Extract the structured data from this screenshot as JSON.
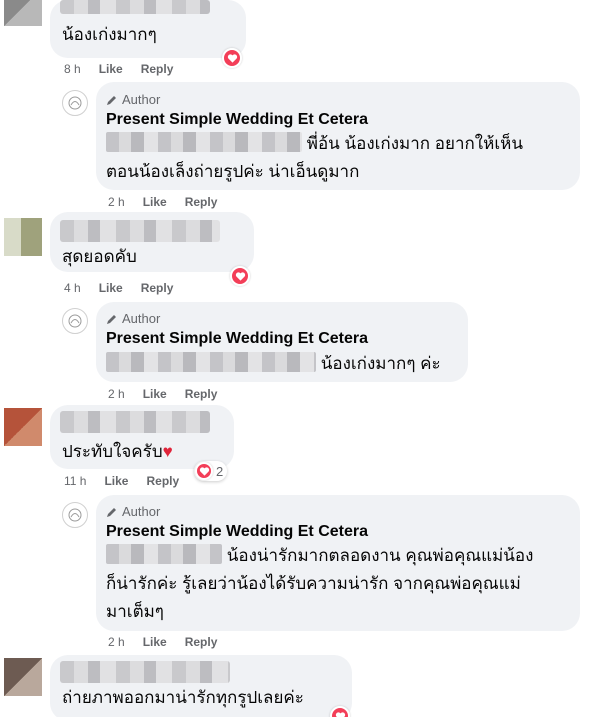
{
  "comments": [
    {
      "text": "น้องเก่งมากๆ",
      "time": "8 h",
      "like": "Like",
      "reply": "Reply",
      "reaction_count": "",
      "page_reply": {
        "author_label": "Author",
        "page_name": "Present Simple Wedding Et Cetera",
        "line1": "พี่อ้น น้องเก่งมาก อยากให้เห็น",
        "line2": "ตอนน้องเล็งถ่ายรูปค่ะ น่าเอ็นดูมาก",
        "line3": "",
        "time": "2 h",
        "like": "Like",
        "reply": "Reply"
      }
    },
    {
      "text": "สุดยอดคับ",
      "time": "4 h",
      "like": "Like",
      "reply": "Reply",
      "reaction_count": "",
      "page_reply": {
        "author_label": "Author",
        "page_name": "Present Simple Wedding Et Cetera",
        "line1": "น้องเก่งมากๆ ค่ะ",
        "line2": "",
        "line3": "",
        "time": "2 h",
        "like": "Like",
        "reply": "Reply"
      }
    },
    {
      "text": "ประทับใจครับ",
      "time": "11 h",
      "like": "Like",
      "reply": "Reply",
      "reaction_count": "2",
      "page_reply": {
        "author_label": "Author",
        "page_name": "Present Simple Wedding Et Cetera",
        "line1": "น้องน่ารักมากตลอดงาน คุณพ่อคุณแม่น้อง",
        "line2": "ก็น่ารักค่ะ รู้เลยว่าน้องได้รับความน่ารัก จากคุณพ่อคุณแม่",
        "line3": "มาเต็มๆ",
        "time": "2 h",
        "like": "Like",
        "reply": "Reply"
      }
    },
    {
      "text": "ถ่ายภาพออกมาน่ารักทุกรูปเลยค่ะ"
    }
  ],
  "colors": {
    "bubble": "#f0f2f5",
    "heart": "#f33e58",
    "meta": "#65676b"
  },
  "icons": {
    "author_badge": "pencil-icon",
    "reaction": "heart-icon"
  }
}
